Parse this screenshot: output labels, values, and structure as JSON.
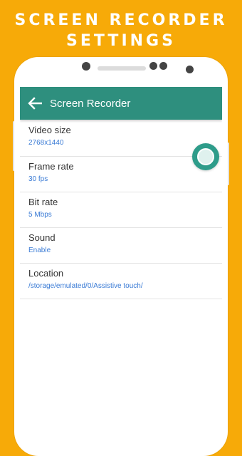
{
  "promo": {
    "line1": "SCREEN RECORDER",
    "line2": "SETTINGS"
  },
  "appbar": {
    "back_icon": "arrow-left-icon",
    "title": "Screen Recorder"
  },
  "settings": [
    {
      "label": "Video size",
      "value": "2768x1440"
    },
    {
      "label": "Frame rate",
      "value": "30 fps"
    },
    {
      "label": "Bit rate",
      "value": "5 Mbps"
    },
    {
      "label": "Sound",
      "value": "Enable"
    },
    {
      "label": "Location",
      "value": "/storage/emulated/0/Assistive touch/"
    }
  ],
  "colors": {
    "background": "#F7AA08",
    "appbar": "#2E8F7E",
    "value_text": "#3A7BD5",
    "floating_button": "#2E9C8A"
  },
  "floating_button": {
    "icon": "assistive-touch-icon"
  }
}
